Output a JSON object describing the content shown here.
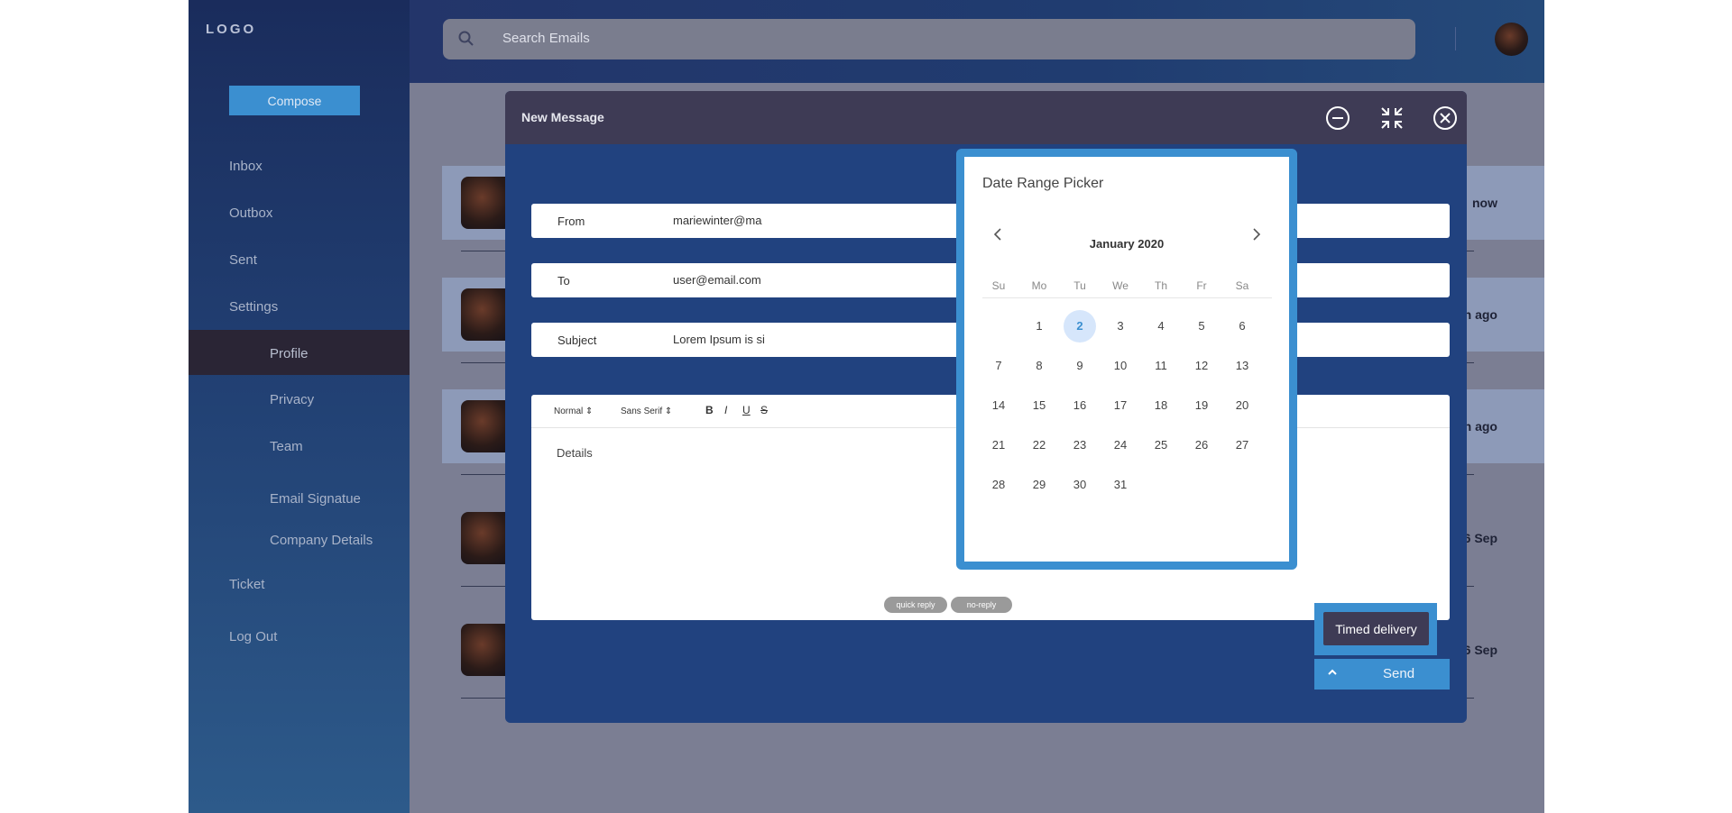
{
  "sidebar": {
    "logo": "LOGO",
    "compose": "Compose",
    "items": {
      "inbox": "Inbox",
      "outbox": "Outbox",
      "sent": "Sent",
      "settings": "Settings",
      "profile": "Profile",
      "privacy": "Privacy",
      "team": "Team",
      "email_signature": "Email Signatue",
      "company_details": "Company Details",
      "ticket": "Ticket",
      "logout": "Log Out"
    }
  },
  "header": {
    "search_placeholder": "Search Emails"
  },
  "list": {
    "times": [
      "now",
      "n ago",
      "n ago",
      "6 Sep",
      "6 Sep"
    ]
  },
  "modal": {
    "title": "New Message",
    "from_label": "From",
    "from_value": "mariewinter@ma",
    "to_label": "To",
    "to_value": "user@email.com",
    "subject_label": "Subject",
    "subject_value": "Lorem Ipsum is si",
    "toolbar": {
      "format": "Normal",
      "font": "Sans Serif",
      "bold": "B",
      "italic": "I",
      "underline": "U",
      "strike": "S"
    },
    "body_placeholder": "Details",
    "chips": [
      "quick reply",
      "no-reply"
    ],
    "timed_delivery": "Timed delivery",
    "send": "Send"
  },
  "date_picker": {
    "title": "Date Range Picker",
    "month": "January 2020",
    "weekdays": [
      "Su",
      "Mo",
      "Tu",
      "We",
      "Th",
      "Fr",
      "Sa"
    ],
    "selected_day": "2",
    "days": [
      [
        "",
        "1",
        "2",
        "3",
        "4",
        "5",
        "6"
      ],
      [
        "7",
        "8",
        "9",
        "10",
        "11",
        "12",
        "13"
      ],
      [
        "14",
        "15",
        "16",
        "17",
        "18",
        "19",
        "20"
      ],
      [
        "21",
        "22",
        "23",
        "24",
        "25",
        "26",
        "27"
      ],
      [
        "28",
        "29",
        "30",
        "31",
        "",
        "",
        ""
      ]
    ]
  },
  "colors": {
    "accent": "#3b8fd0",
    "header": "#3e3b55",
    "modal_bg": "#21427f"
  }
}
